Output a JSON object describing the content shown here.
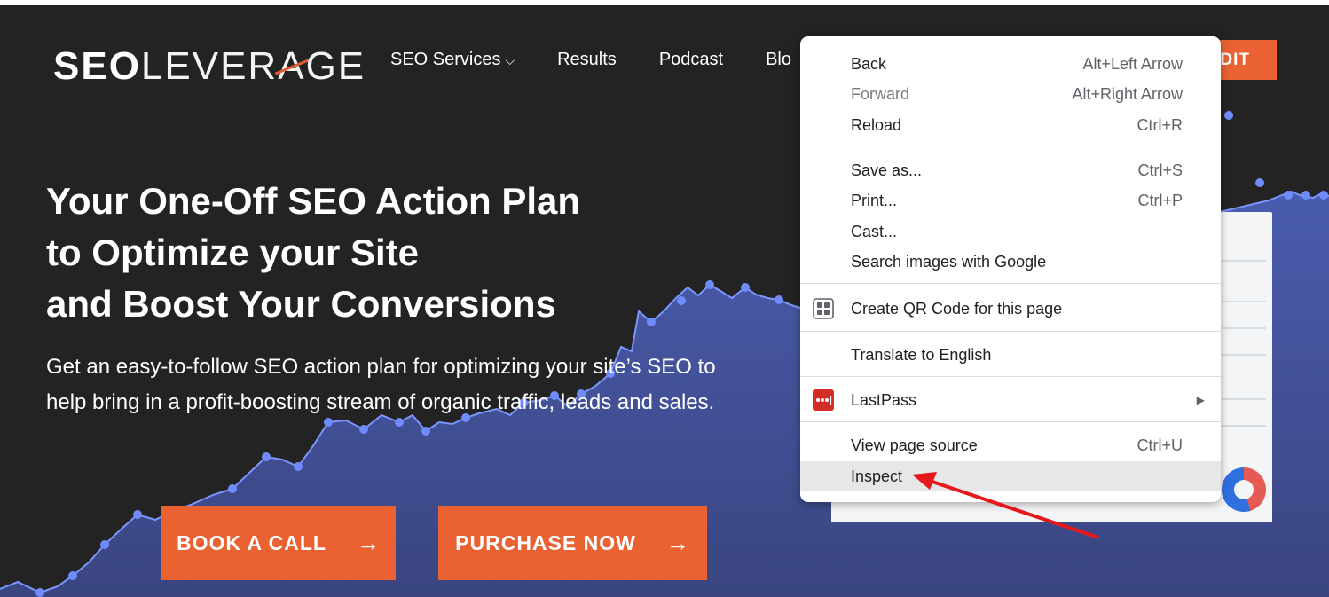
{
  "brand": {
    "logo_bold": "SEO",
    "logo_thin_1": "LEVER",
    "logo_a": "A",
    "logo_thin_2": "GE"
  },
  "nav": {
    "items": [
      "SEO Services",
      "Results",
      "Podcast",
      "Blo"
    ],
    "dropdown_chevron": "⌵"
  },
  "header_cta": {
    "label": "DIT"
  },
  "hero": {
    "headline_lines": [
      "Your One-Off SEO Action Plan",
      "to Optimize your Site",
      "and Boost Your Conversions"
    ],
    "subcopy": "Get an easy-to-follow SEO action plan for optimizing your site’s SEO to help bring in a profit-boosting stream of organic traffic, leads and sales.",
    "book_call_label": "BOOK A CALL",
    "purchase_label": "PURCHASE NOW",
    "button_arrow": "→"
  },
  "context_menu": {
    "back": {
      "label": "Back",
      "shortcut": "Alt+Left Arrow"
    },
    "forward": {
      "label": "Forward",
      "shortcut": "Alt+Right Arrow"
    },
    "reload": {
      "label": "Reload",
      "shortcut": "Ctrl+R"
    },
    "save_as": {
      "label": "Save as...",
      "shortcut": "Ctrl+S"
    },
    "print": {
      "label": "Print...",
      "shortcut": "Ctrl+P"
    },
    "cast": {
      "label": "Cast..."
    },
    "search_images": {
      "label": "Search images with Google"
    },
    "qr_code": {
      "label": "Create QR Code for this page",
      "icon": "qr-code-icon"
    },
    "translate": {
      "label": "Translate to English"
    },
    "lastpass": {
      "label": "LastPass",
      "icon": "lastpass-icon",
      "submenu_arrow": "▶"
    },
    "view_source": {
      "label": "View page source",
      "shortcut": "Ctrl+U"
    },
    "inspect": {
      "label": "Inspect"
    }
  },
  "colors": {
    "hero_bg": "#232323",
    "accent_orange": "#ea6232",
    "chart_fill": "#3f4f9a",
    "chart_dot": "#6f8cff",
    "annotation_arrow": "#e5191c",
    "lastpass_red": "#d32d27"
  }
}
